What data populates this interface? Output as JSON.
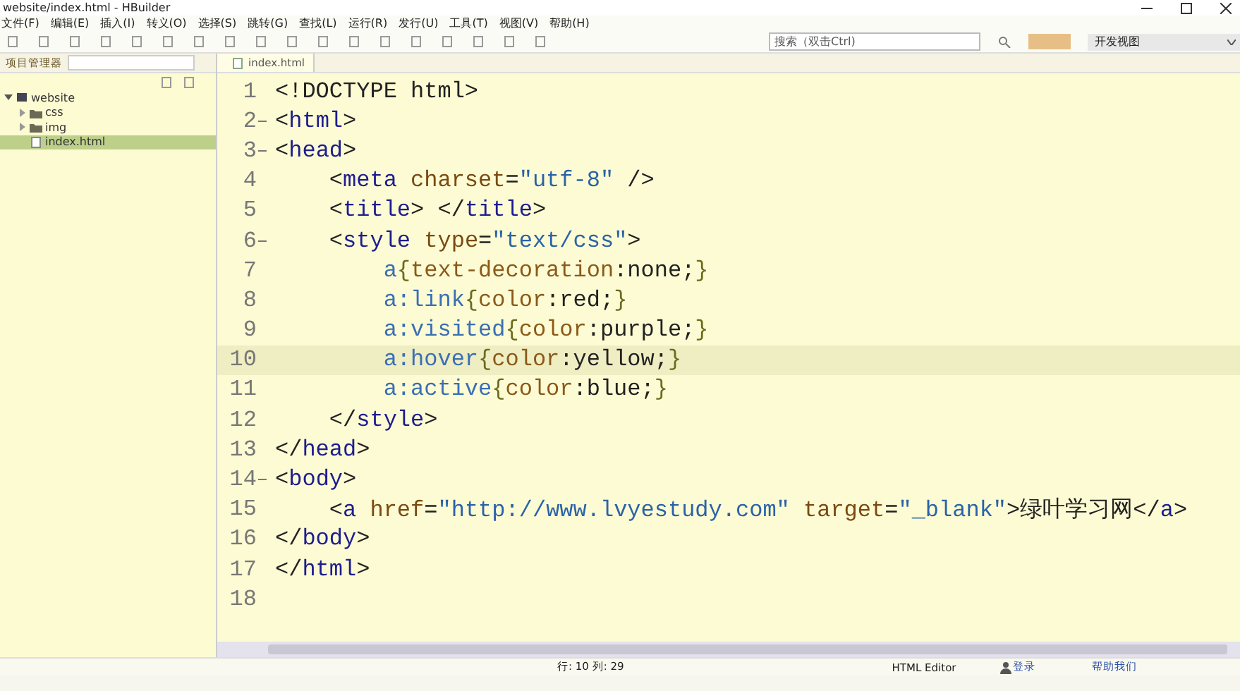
{
  "window": {
    "title": "website/index.html - HBuilder"
  },
  "menu": [
    "文件(F)",
    "编辑(E)",
    "插入(I)",
    "转义(O)",
    "选择(S)",
    "跳转(G)",
    "查找(L)",
    "运行(R)",
    "发行(U)",
    "工具(T)",
    "视图(V)",
    "帮助(H)"
  ],
  "toolbar": {
    "search": {
      "placeholder": "搜索（双击Ctrl)"
    },
    "perspective": "开发视图"
  },
  "project_panel": {
    "title": "项目管理器",
    "tree": [
      {
        "label": "website",
        "kind": "project",
        "expanded": true,
        "selected": false,
        "children": [
          {
            "label": "css",
            "kind": "folder",
            "expanded": false,
            "selected": false
          },
          {
            "label": "img",
            "kind": "folder",
            "expanded": false,
            "selected": false
          },
          {
            "label": "index.html",
            "kind": "file",
            "selected": true
          }
        ]
      }
    ]
  },
  "editor": {
    "tab": {
      "label": "index.html",
      "selected": true
    },
    "lines": [
      {
        "number": "1",
        "foldable": false,
        "current": false,
        "tokens": [
          {
            "kind": "punct",
            "text": "<!DOCTYPE html>"
          }
        ]
      },
      {
        "number": "2",
        "foldable": true,
        "current": false,
        "tokens": [
          {
            "kind": "punct",
            "text": "<"
          },
          {
            "kind": "tag",
            "text": "html"
          },
          {
            "kind": "punct",
            "text": ">"
          }
        ]
      },
      {
        "number": "3",
        "foldable": true,
        "current": false,
        "tokens": [
          {
            "kind": "punct",
            "text": "<"
          },
          {
            "kind": "tag",
            "text": "head"
          },
          {
            "kind": "punct",
            "text": ">"
          }
        ]
      },
      {
        "number": "4",
        "foldable": false,
        "current": false,
        "tokens": [
          {
            "kind": "punct",
            "text": "    <"
          },
          {
            "kind": "tag",
            "text": "meta"
          },
          {
            "kind": "attr",
            "text": " charset"
          },
          {
            "kind": "punct",
            "text": "="
          },
          {
            "kind": "string",
            "text": "\"utf-8\""
          },
          {
            "kind": "punct",
            "text": " />"
          }
        ]
      },
      {
        "number": "5",
        "foldable": false,
        "current": false,
        "tokens": [
          {
            "kind": "punct",
            "text": "    <"
          },
          {
            "kind": "tag",
            "text": "title"
          },
          {
            "kind": "punct",
            "text": "> </"
          },
          {
            "kind": "tag",
            "text": "title"
          },
          {
            "kind": "punct",
            "text": ">"
          }
        ]
      },
      {
        "number": "6",
        "foldable": true,
        "current": false,
        "tokens": [
          {
            "kind": "punct",
            "text": "    <"
          },
          {
            "kind": "tag",
            "text": "style"
          },
          {
            "kind": "attr",
            "text": " type"
          },
          {
            "kind": "punct",
            "text": "="
          },
          {
            "kind": "string",
            "text": "\"text/css\""
          },
          {
            "kind": "punct",
            "text": ">"
          }
        ]
      },
      {
        "number": "7",
        "foldable": false,
        "current": false,
        "tokens": [
          {
            "kind": "selector",
            "text": "        a"
          },
          {
            "kind": "brace",
            "text": "{"
          },
          {
            "kind": "property",
            "text": "text-decoration"
          },
          {
            "kind": "punct",
            "text": ":none;"
          },
          {
            "kind": "brace",
            "text": "}"
          }
        ]
      },
      {
        "number": "8",
        "foldable": false,
        "current": false,
        "tokens": [
          {
            "kind": "selector",
            "text": "        a:link"
          },
          {
            "kind": "brace",
            "text": "{"
          },
          {
            "kind": "property",
            "text": "color"
          },
          {
            "kind": "punct",
            "text": ":red;"
          },
          {
            "kind": "brace",
            "text": "}"
          }
        ]
      },
      {
        "number": "9",
        "foldable": false,
        "current": false,
        "tokens": [
          {
            "kind": "selector",
            "text": "        a:visited"
          },
          {
            "kind": "brace",
            "text": "{"
          },
          {
            "kind": "property",
            "text": "color"
          },
          {
            "kind": "punct",
            "text": ":purple;"
          },
          {
            "kind": "brace",
            "text": "}"
          }
        ]
      },
      {
        "number": "10",
        "foldable": false,
        "current": true,
        "tokens": [
          {
            "kind": "selector",
            "text": "        a:hover"
          },
          {
            "kind": "brace",
            "text": "{"
          },
          {
            "kind": "property",
            "text": "color"
          },
          {
            "kind": "punct",
            "text": ":yellow;"
          },
          {
            "kind": "brace",
            "text": "}"
          }
        ]
      },
      {
        "number": "11",
        "foldable": false,
        "current": false,
        "tokens": [
          {
            "kind": "selector",
            "text": "        a:active"
          },
          {
            "kind": "brace",
            "text": "{"
          },
          {
            "kind": "property",
            "text": "color"
          },
          {
            "kind": "punct",
            "text": ":blue;"
          },
          {
            "kind": "brace",
            "text": "}"
          }
        ]
      },
      {
        "number": "12",
        "foldable": false,
        "current": false,
        "tokens": [
          {
            "kind": "punct",
            "text": "    </"
          },
          {
            "kind": "tag",
            "text": "style"
          },
          {
            "kind": "punct",
            "text": ">"
          }
        ]
      },
      {
        "number": "13",
        "foldable": false,
        "current": false,
        "tokens": [
          {
            "kind": "punct",
            "text": "</"
          },
          {
            "kind": "tag",
            "text": "head"
          },
          {
            "kind": "punct",
            "text": ">"
          }
        ]
      },
      {
        "number": "14",
        "foldable": true,
        "current": false,
        "tokens": [
          {
            "kind": "punct",
            "text": "<"
          },
          {
            "kind": "tag",
            "text": "body"
          },
          {
            "kind": "punct",
            "text": ">"
          }
        ]
      },
      {
        "number": "15",
        "foldable": false,
        "current": false,
        "tokens": [
          {
            "kind": "punct",
            "text": "    <"
          },
          {
            "kind": "tag",
            "text": "a"
          },
          {
            "kind": "attr",
            "text": " href"
          },
          {
            "kind": "punct",
            "text": "="
          },
          {
            "kind": "string",
            "text": "\"http://www.lvyestudy.com\""
          },
          {
            "kind": "attr",
            "text": " target"
          },
          {
            "kind": "punct",
            "text": "="
          },
          {
            "kind": "string",
            "text": "\"_blank\""
          },
          {
            "kind": "punct",
            "text": ">绿叶学习网</"
          },
          {
            "kind": "tag",
            "text": "a"
          },
          {
            "kind": "punct",
            "text": ">"
          }
        ]
      },
      {
        "number": "16",
        "foldable": false,
        "current": false,
        "tokens": [
          {
            "kind": "punct",
            "text": "</"
          },
          {
            "kind": "tag",
            "text": "body"
          },
          {
            "kind": "punct",
            "text": ">"
          }
        ]
      },
      {
        "number": "17",
        "foldable": false,
        "current": false,
        "tokens": [
          {
            "kind": "punct",
            "text": "</"
          },
          {
            "kind": "tag",
            "text": "html"
          },
          {
            "kind": "punct",
            "text": ">"
          }
        ]
      },
      {
        "number": "18",
        "foldable": false,
        "current": false
      }
    ]
  },
  "status_bar": {
    "position": "行: 10 列: 29",
    "editor_type": "HTML Editor",
    "login": "登录",
    "help": "帮助我们"
  }
}
